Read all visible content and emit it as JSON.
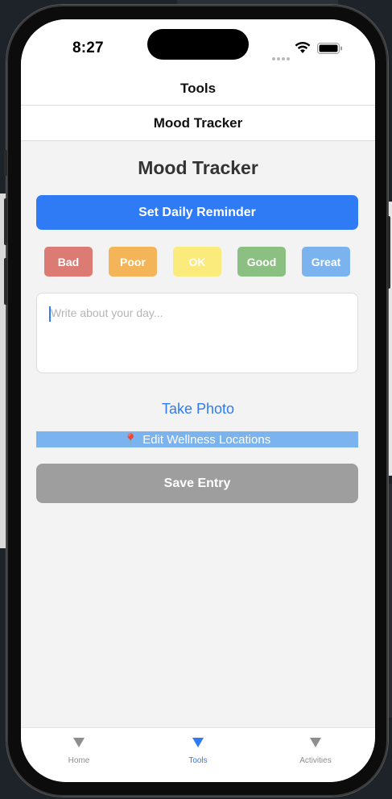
{
  "status_bar": {
    "time": "8:27"
  },
  "header": {
    "tools_title": "Tools",
    "screen_title": "Mood Tracker"
  },
  "main": {
    "title": "Mood Tracker",
    "reminder_label": "Set Daily Reminder",
    "moods": [
      {
        "label": "Bad",
        "color": "#dc7b74"
      },
      {
        "label": "Poor",
        "color": "#f3b558"
      },
      {
        "label": "OK",
        "color": "#fbea7c"
      },
      {
        "label": "Good",
        "color": "#8cbf82"
      },
      {
        "label": "Great",
        "color": "#7bb3ee"
      }
    ],
    "journal_placeholder": "Write about your day...",
    "take_photo_label": "Take Photo",
    "locations_label": "Edit Wellness Locations",
    "locations_icon": "pin-icon",
    "save_label": "Save Entry"
  },
  "tab_bar": {
    "tabs": [
      {
        "label": "Home",
        "active": false
      },
      {
        "label": "Tools",
        "active": true
      },
      {
        "label": "Activities",
        "active": false
      }
    ]
  },
  "colors": {
    "accent": "#2f7bf5",
    "save_disabled": "#9e9e9e"
  }
}
